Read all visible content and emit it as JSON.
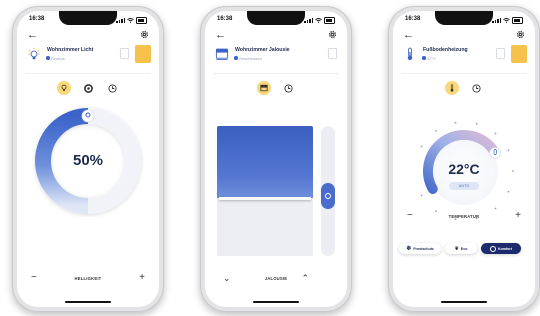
{
  "status_time": "16:38",
  "colors": {
    "accent": "#3b63c9",
    "favorite": "#f6c24b",
    "dark": "#1d2b4f"
  },
  "phones": [
    {
      "device_title": "Wohnzimmer Licht",
      "device_subtitle": "Ein/Aus",
      "device_icon": "lightbulb-icon",
      "value": "50%",
      "progress": 0.5,
      "footer_label": "HELLIGKEIT",
      "footer_left": "−",
      "footer_right": "+"
    },
    {
      "device_title": "Wohnzimmer Jalousie",
      "device_subtitle": "Geschlossen",
      "device_icon": "blind-icon",
      "blind_level": 0.55,
      "footer_label": "JALOUSIE",
      "footer_left": "⌄",
      "footer_right": "⌃"
    },
    {
      "device_title": "Fußbodenheizung",
      "device_subtitle": "22°C",
      "device_icon": "thermometer-icon",
      "value": "22°C",
      "mode_badge": "AUTO",
      "footer_label": "TEMPERATUR",
      "footer_left": "−",
      "footer_right": "+",
      "buttons": [
        "Frostschutz",
        "Eco",
        "Komfort"
      ]
    }
  ]
}
